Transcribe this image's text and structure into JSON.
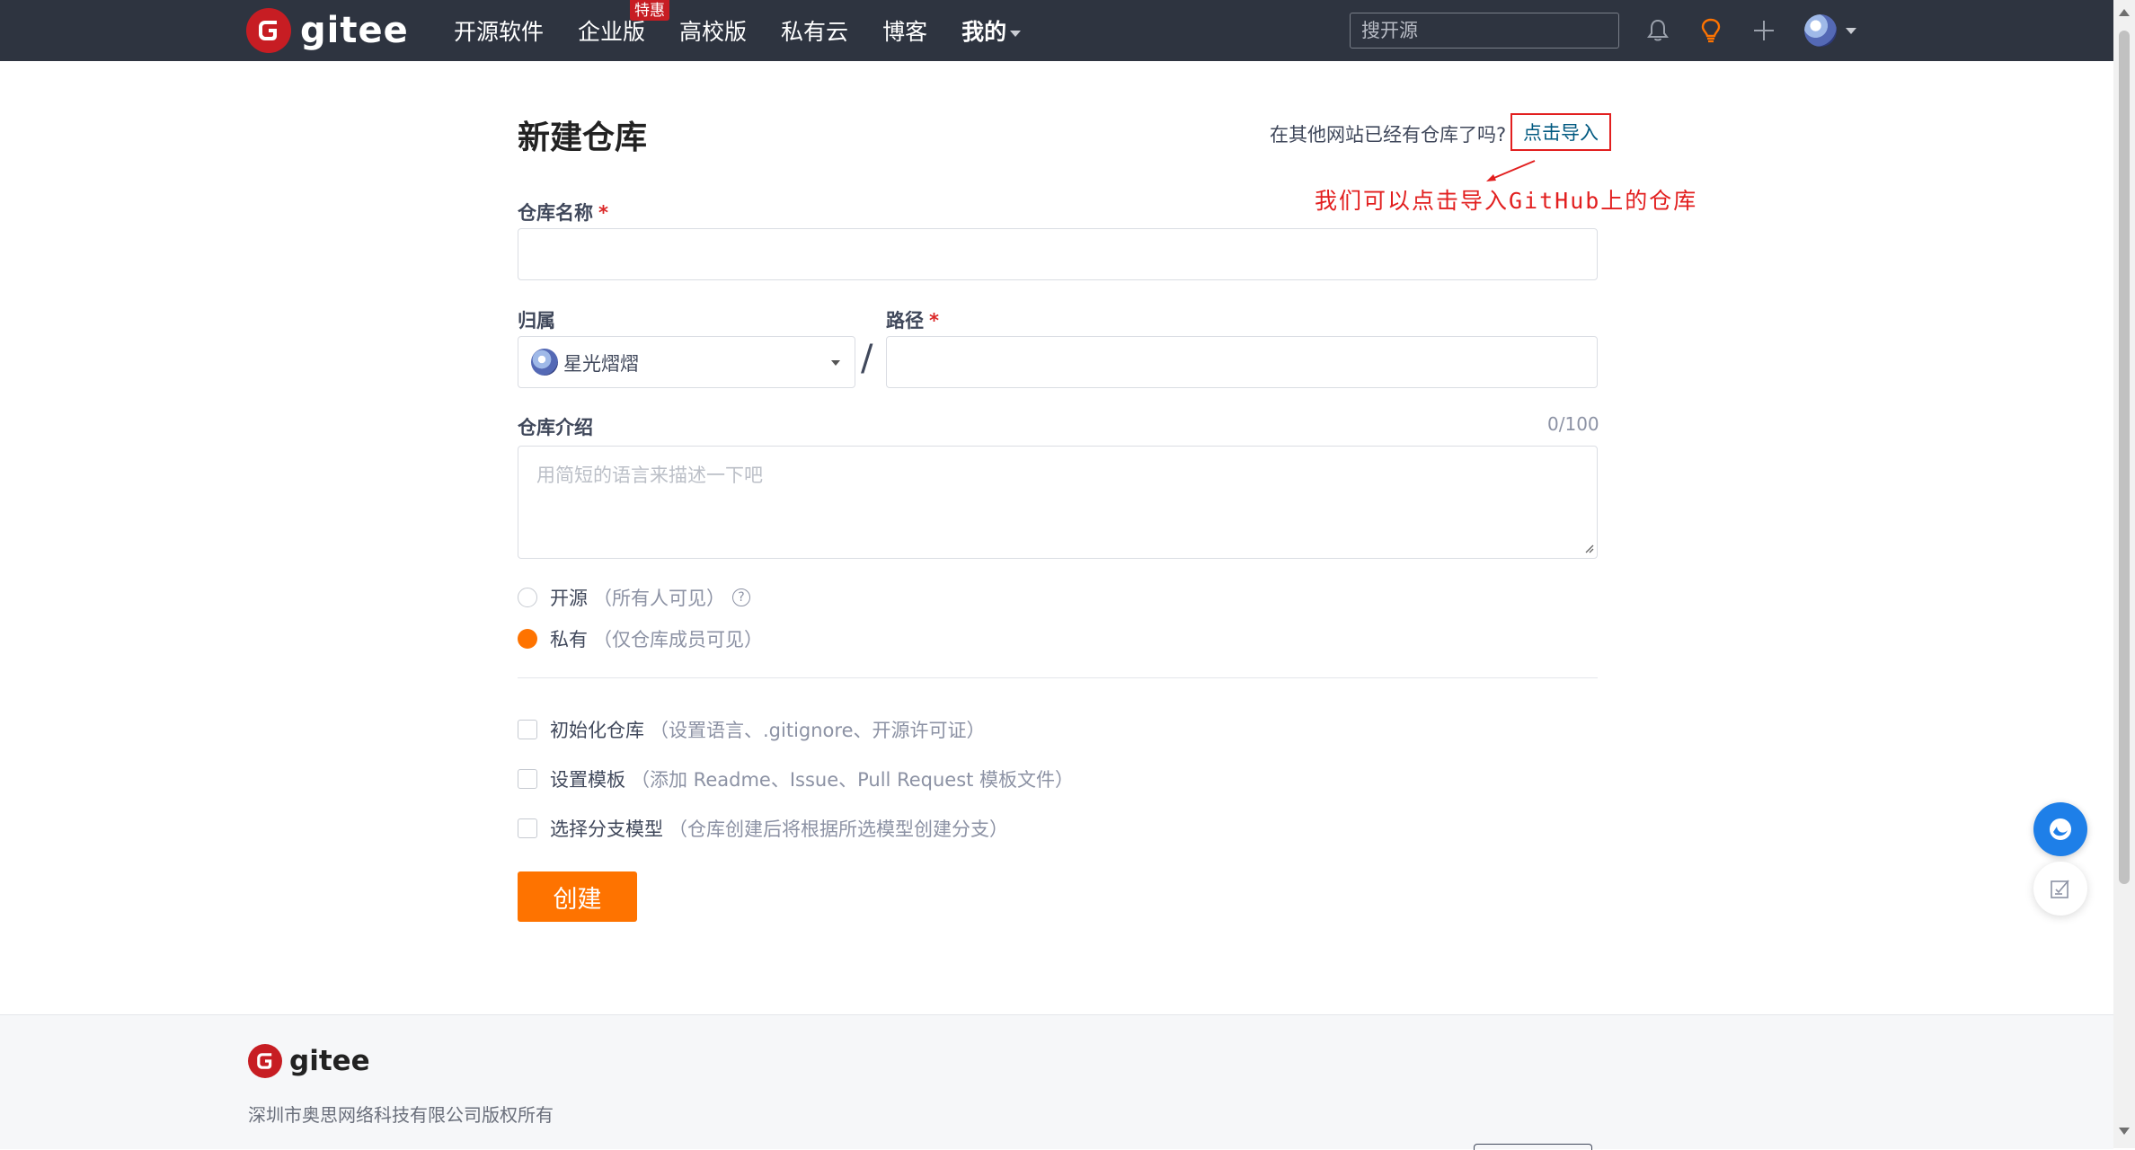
{
  "nav": {
    "logo_text": "gitee",
    "items": [
      {
        "label": "开源软件"
      },
      {
        "label": "企业版",
        "badge": "特惠"
      },
      {
        "label": "高校版"
      },
      {
        "label": "私有云"
      },
      {
        "label": "博客"
      },
      {
        "label": "我的"
      }
    ],
    "search_placeholder": "搜开源",
    "icons": [
      "bell-icon",
      "lightbulb-icon",
      "plus-icon",
      "user-avatar"
    ]
  },
  "form": {
    "title": "新建仓库",
    "import_question": "在其他网站已经有仓库了吗?",
    "import_link": "点击导入",
    "annotation": "我们可以点击导入GitHub上的仓库",
    "repo_name_label": "仓库名称",
    "required_mark": "*",
    "owner_label": "归属",
    "owner_value": "星光熠熠",
    "path_label": "路径",
    "path_separator": "/",
    "desc_label": "仓库介绍",
    "desc_counter": "0/100",
    "desc_placeholder": "用简短的语言来描述一下吧",
    "visibility": [
      {
        "label": "开源",
        "hint": "（所有人可见）",
        "checked": false
      },
      {
        "label": "私有",
        "hint": "（仅仓库成员可见）",
        "checked": true
      }
    ],
    "options": [
      {
        "label": "初始化仓库",
        "hint": "（设置语言、.gitignore、开源许可证）"
      },
      {
        "label": "设置模板",
        "hint": "（添加 Readme、Issue、Pull Request 模板文件）"
      },
      {
        "label": "选择分支模型",
        "hint": "（仓库创建后将根据所选模型创建分支）"
      }
    ],
    "submit_label": "创建"
  },
  "footer": {
    "logo_text": "gitee",
    "copyright": "深圳市奥思网络科技有限公司版权所有"
  },
  "colors": {
    "nav_bg": "#2e3440",
    "brand_red": "#c71d23",
    "accent_orange": "#fe7300",
    "annotation_red": "#e21f1f",
    "link": "#005980"
  }
}
